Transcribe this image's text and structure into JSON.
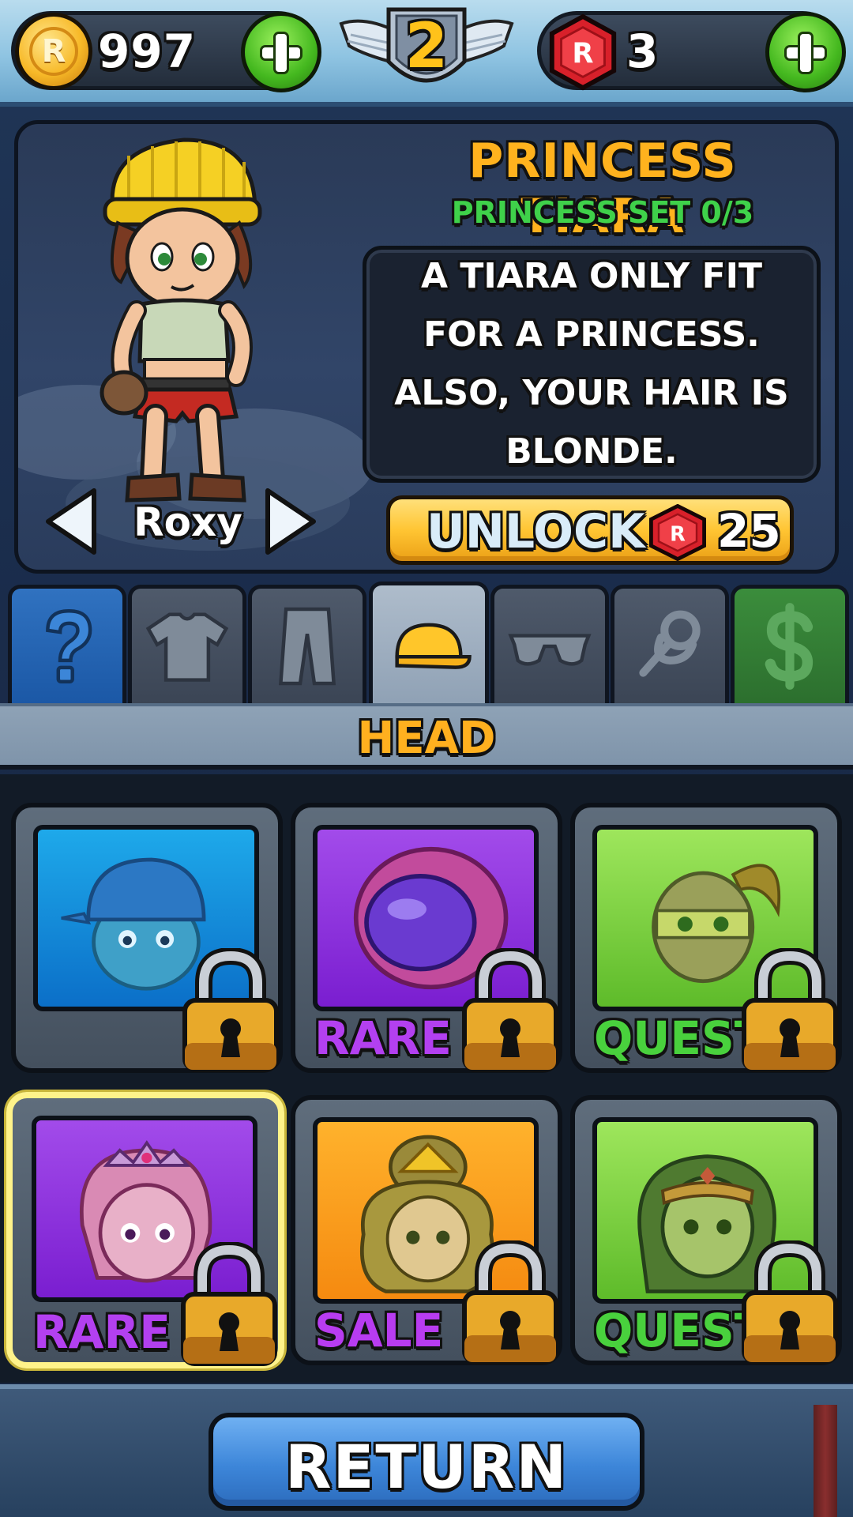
{
  "currency": {
    "coins": "997",
    "coin_symbol": "R",
    "gems": "3",
    "gem_symbol": "R"
  },
  "player": {
    "level": "2"
  },
  "item_detail": {
    "title": "PRINCESS TIARA",
    "set_progress": "PRINCESS SET 0/3",
    "description": "A TIARA ONLY FIT FOR A PRINCESS. ALSO, YOUR HAIR IS BLONDE.",
    "unlock_label": "UNLOCK",
    "unlock_price": "25"
  },
  "character": {
    "name": "Roxy"
  },
  "tabs": [
    {
      "name": "random",
      "icon": "question-mark-icon",
      "active": false
    },
    {
      "name": "shirt",
      "icon": "shirt-icon",
      "active": false
    },
    {
      "name": "pants",
      "icon": "pants-icon",
      "active": false
    },
    {
      "name": "head",
      "icon": "cap-icon",
      "active": true
    },
    {
      "name": "glasses",
      "icon": "sunglasses-icon",
      "active": false
    },
    {
      "name": "accessory",
      "icon": "rope-icon",
      "active": false
    },
    {
      "name": "shop",
      "icon": "dollar-icon",
      "active": false
    }
  ],
  "category": {
    "title": "HEAD"
  },
  "items": [
    {
      "art": "baseball-helmet",
      "background": "blue",
      "label": "",
      "locked": true,
      "selected": false
    },
    {
      "art": "space-helmet",
      "background": "purple",
      "label": "RARE",
      "locked": true,
      "selected": false
    },
    {
      "art": "ninja-mask",
      "background": "green",
      "label": "QUEST",
      "locked": true,
      "selected": false
    },
    {
      "art": "princess-tiara",
      "background": "purple",
      "label": "RARE",
      "locked": true,
      "selected": true
    },
    {
      "art": "golden-hair-crown",
      "background": "orange",
      "label": "SALE",
      "locked": true,
      "selected": false
    },
    {
      "art": "hero-headband",
      "background": "green",
      "label": "QUEST",
      "locked": true,
      "selected": false
    }
  ],
  "footer": {
    "return_label": "RETURN"
  },
  "colors": {
    "coin_gold": "#f7b928",
    "gem_red": "#d8202a",
    "plus_green": "#44b81f",
    "title_orange": "#ffb21e",
    "set_green": "#3fd14a",
    "rare_purple": "#b340f0",
    "quest_green": "#49d13d",
    "return_blue": "#3d86d9"
  }
}
